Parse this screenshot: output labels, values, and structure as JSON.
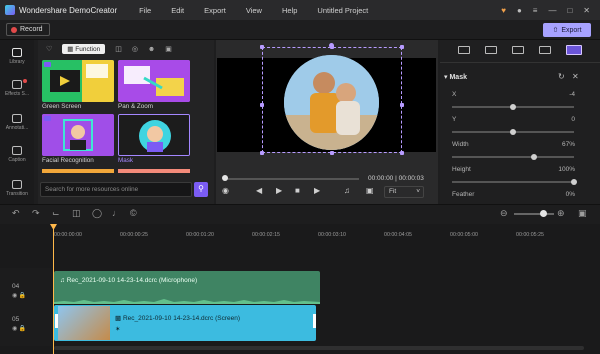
{
  "titlebar": {
    "app_name": "Wondershare DemoCreator",
    "menu": [
      "File",
      "Edit",
      "Export",
      "View",
      "Help"
    ],
    "project_name": "Untitled Project"
  },
  "toolbar": {
    "record_label": "Record",
    "export_label": "Export"
  },
  "left_nav": [
    {
      "label": "Library",
      "icon": "library-icon"
    },
    {
      "label": "Effects S...",
      "icon": "effects-icon"
    },
    {
      "label": "Annotati...",
      "icon": "annotation-icon"
    },
    {
      "label": "Caption",
      "icon": "caption-icon"
    },
    {
      "label": "Transition",
      "icon": "transition-icon"
    }
  ],
  "library": {
    "tabs": [
      {
        "label": "",
        "icon": "heart-icon"
      },
      {
        "label": "Function",
        "icon": "function-icon",
        "active": true
      },
      {
        "label": "",
        "icon": "layout-icon"
      },
      {
        "label": "",
        "icon": "camera-icon"
      },
      {
        "label": "",
        "icon": "people-icon"
      },
      {
        "label": "",
        "icon": "crop-icon"
      }
    ],
    "items": [
      {
        "label": "Green Screen",
        "selected": false
      },
      {
        "label": "Pan & Zoom",
        "selected": false
      },
      {
        "label": "Facial Recognition",
        "selected": false
      },
      {
        "label": "Mask",
        "selected": true
      }
    ],
    "search_placeholder": "Search for more resources online"
  },
  "preview": {
    "timecode": "00:00:00 | 00:00:03",
    "fit_label": "Fit"
  },
  "properties": {
    "section_title": "Mask",
    "fields": [
      {
        "label": "X",
        "value": "-4",
        "slider": 0.5
      },
      {
        "label": "Y",
        "value": "0",
        "slider": 0.5
      },
      {
        "label": "Width",
        "value": "67%",
        "slider": 0.67
      },
      {
        "label": "Height",
        "value": "100%",
        "slider": 1.0
      },
      {
        "label": "Feather",
        "value": "0%",
        "slider": 0.0
      }
    ]
  },
  "timeline": {
    "ruler": [
      "00:00:00:00",
      "00:00:00:25",
      "00:00:01:20",
      "00:00:02:15",
      "00:00:03:10",
      "00:00:04:05",
      "00:00:05:00",
      "00:00:05:25"
    ],
    "tracks": [
      {
        "number": "04",
        "clip": "Rec_2021-09-10 14-23-14.dcrc (Microphone)"
      },
      {
        "number": "05",
        "clip": "Rec_2021-09-10 14-23-14.dcrc (Screen)"
      }
    ]
  },
  "colors": {
    "accent": "#7b5cf4",
    "export_bg": "#a7a2ff",
    "audio_clip": "#3f8463",
    "video_clip": "#3cbbe0",
    "playhead": "#ffb84a"
  }
}
